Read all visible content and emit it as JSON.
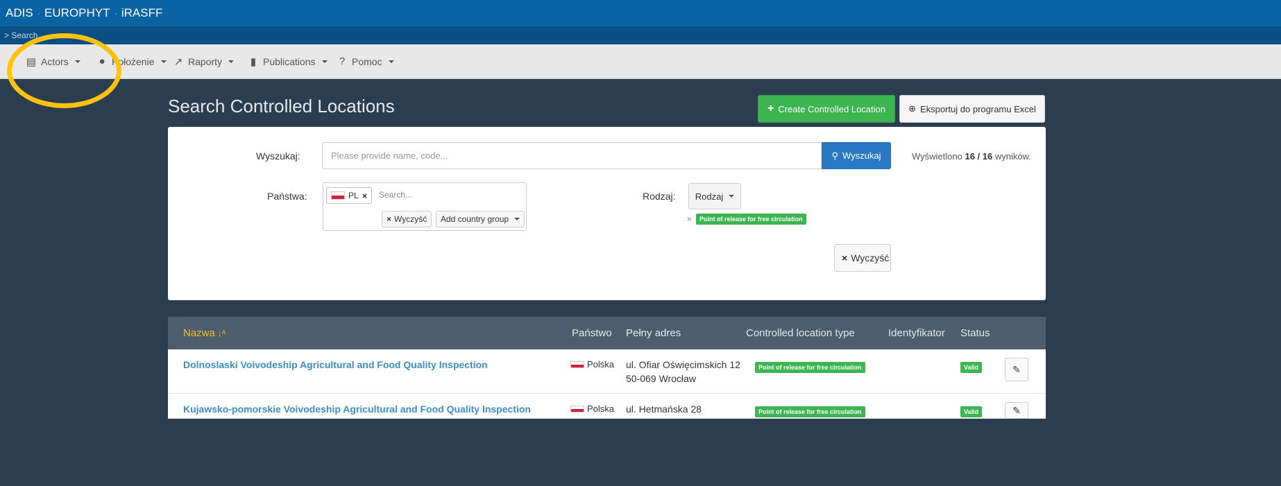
{
  "topbar": {
    "items": [
      "ADIS",
      "EUROPHYT",
      "iRASFF"
    ],
    "separator": "·"
  },
  "breadcrumb": "> Search",
  "menu": {
    "items": [
      {
        "label": "Actors",
        "icon": "id-card-icon",
        "glyph": "▤"
      },
      {
        "label": "Położenie",
        "icon": "globe-icon",
        "glyph": "●"
      },
      {
        "label": "Raporty",
        "icon": "line-chart-icon",
        "glyph": "↗"
      },
      {
        "label": "Publications",
        "icon": "book-icon",
        "glyph": "▮"
      },
      {
        "label": "Pomoc",
        "icon": "question-circle-icon",
        "glyph": "?"
      }
    ]
  },
  "page": {
    "title": "Search Controlled Locations",
    "create_label": "Create Controlled Location",
    "export_label": "Eksportuj do programu Excel"
  },
  "filters": {
    "search_label": "Wyszukaj:",
    "search_placeholder": "Please provide name, code...",
    "search_button": "Wyszukaj",
    "results_prefix": "Wyświetlono",
    "results_count": "16 / 16",
    "results_suffix": "wyników.",
    "countries_label": "Państwa:",
    "country_tag": "PL",
    "country_search_placeholder": "Search...",
    "clear_label": "Wyczyść",
    "add_group_label": "Add country group",
    "type_label": "Rodzaj:",
    "type_button": "Rodzaj",
    "selected_type": "Point of release for free circulation",
    "clear_all_label": "Wyczyść"
  },
  "table": {
    "headers": {
      "name": "Nazwa",
      "country": "Państwo",
      "address": "Pełny adres",
      "type": "Controlled location type",
      "identifier": "Identyfikator",
      "status": "Status"
    },
    "rows": [
      {
        "name": "Dolnoslaski Voivodeship Agricultural and Food Quality Inspection",
        "country": "Polska",
        "address_line1": "ul. Ofiar Oświęcimskich 12",
        "address_line2": "50-069 Wrocław",
        "type": "Point of release for free circulation",
        "identifier": "",
        "status": "Valid"
      },
      {
        "name": "Kujawsko-pomorskie Voivodeship Agricultural and Food Quality Inspection",
        "country": "Polska",
        "address_line1": "ul. Hetmańska 28",
        "address_line2": "",
        "type": "Point of release for free circulation",
        "identifier": "",
        "status": "Valid"
      }
    ]
  },
  "colors": {
    "topbar": "#0a64a4",
    "page_bg": "#2b3e50",
    "accent_green": "#3db651",
    "link_blue": "#3c8dc4",
    "highlight_ring": "#ffc20e"
  }
}
